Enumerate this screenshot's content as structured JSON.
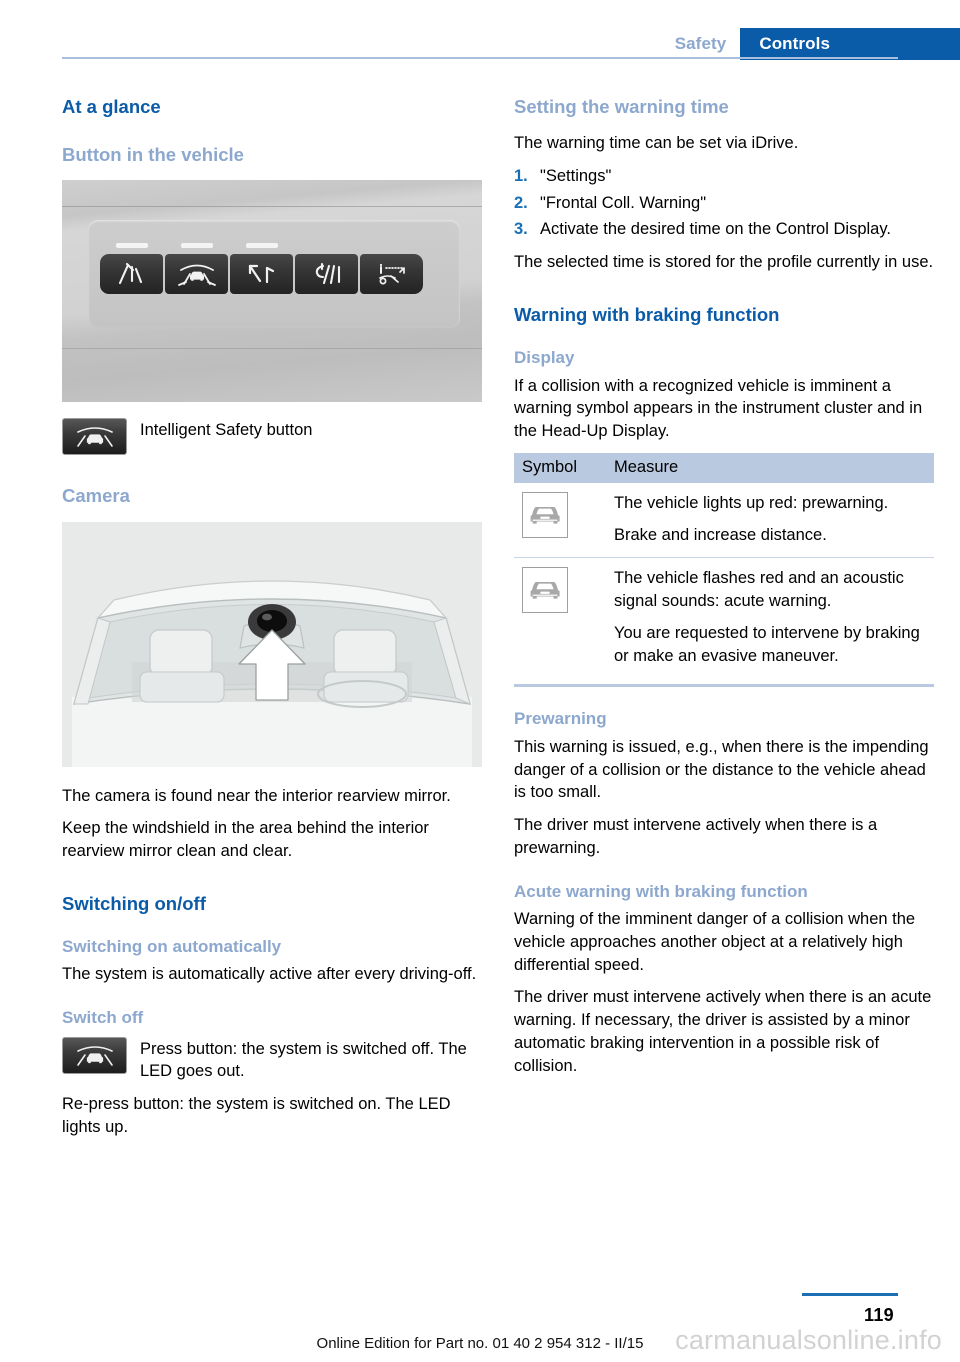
{
  "header": {
    "tab_inactive": "Safety",
    "tab_active": "Controls",
    "accent_dark": "#0b5ca8",
    "accent_light": "#8da8ce"
  },
  "left_column": {
    "title": "At a glance",
    "button_section": {
      "heading": "Button in the vehicle",
      "photo_alt": "button-panel-photo",
      "buttons": [
        "lane-departure-warning-icon",
        "intelligent-safety-icon",
        "lane-change-warning-icon",
        "lane-keeping-assist-icon",
        "active-cruise-control-icon"
      ],
      "caption": "Intelligent Safety button",
      "caption_icon": "intelligent-safety-button-icon"
    },
    "camera_section": {
      "heading": "Camera",
      "illustration_alt": "windshield-camera-illustration",
      "paragraphs": [
        "The camera is found near the interior rearview mirror.",
        "Keep the windshield in the area behind the interior rearview mirror clean and clear."
      ]
    },
    "switching_section": {
      "heading": "Switching on/off",
      "auto_heading": "Switching on automatically",
      "auto_text": "The system is automatically active after every driving-off.",
      "off_heading": "Switch off",
      "off_icon": "intelligent-safety-button-icon",
      "off_icon_text": "Press button: the system is switched off. The LED goes out.",
      "off_text": "Re-press button: the system is switched on. The LED lights up."
    }
  },
  "right_column": {
    "warning_time": {
      "heading": "Setting the warning time",
      "intro": "The warning time can be set via iDrive.",
      "steps": [
        {
          "num": "1.",
          "text": "\"Settings\""
        },
        {
          "num": "2.",
          "text": "\"Frontal Coll. Warning\""
        },
        {
          "num": "3.",
          "text": "Activate the desired time on the Control Display."
        }
      ],
      "outro": "The selected time is stored for the profile currently in use."
    },
    "braking_section": {
      "heading": "Warning with braking function",
      "display_heading": "Display",
      "display_text": "If a collision with a recognized vehicle is imminent a warning symbol appears in the instrument cluster and in the Head-Up Display.",
      "table": {
        "columns": [
          "Symbol",
          "Measure"
        ],
        "header_bg": "#b9c9e0",
        "rows": [
          {
            "symbol": "vehicle-front-warning-icon",
            "lines": [
              "The vehicle lights up red: prewarning.",
              "Brake and increase distance."
            ]
          },
          {
            "symbol": "vehicle-front-warning-icon",
            "lines": [
              "The vehicle flashes red and an acoustic signal sounds: acute warning.",
              "You are requested to intervene by braking or make an evasive maneuver."
            ]
          }
        ]
      },
      "prewarning_heading": "Prewarning",
      "prewarning_p1": "This warning is issued, e.g., when there is the impending danger of a collision or the distance to the vehicle ahead is too small.",
      "prewarning_p2": "The driver must intervene actively when there is a prewarning.",
      "acute_heading": "Acute warning with braking function",
      "acute_p1": "Warning of the imminent danger of a collision when the vehicle approaches another object at a relatively high differential speed.",
      "acute_p2": "The driver must intervene actively when there is an acute warning. If necessary, the driver is assisted by a minor automatic braking intervention in a possible risk of collision."
    }
  },
  "footer": {
    "page_number": "119",
    "note": "Online Edition for Part no. 01 40 2 954 312 - II/15",
    "watermark": "carmanualsonline.info",
    "rule_color": "#1a6fb5"
  }
}
